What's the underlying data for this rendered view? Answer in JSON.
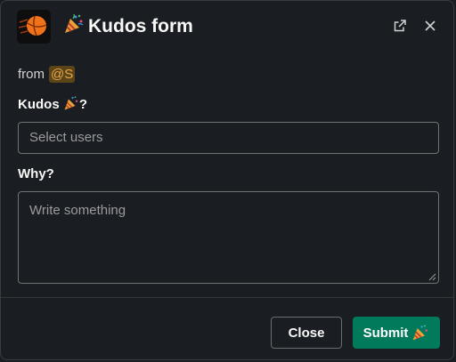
{
  "modal": {
    "title": "Kudos form",
    "title_emoji": "party-popper-icon",
    "app_icon": "basketball-icon",
    "open_in_window": "external-link-icon",
    "close": "close-icon"
  },
  "from": {
    "label": "from",
    "mention": "@S"
  },
  "fields": {
    "kudos_label": "Kudos",
    "kudos_suffix": "?",
    "kudos_placeholder": "Select users",
    "why_label": "Why?",
    "why_placeholder": "Write something"
  },
  "footer": {
    "close_label": "Close",
    "submit_label": "Submit"
  },
  "colors": {
    "background": "#1a1d21",
    "submit": "#007a5a",
    "mention_bg": "#5a4418",
    "mention_text": "#e8a64b"
  }
}
